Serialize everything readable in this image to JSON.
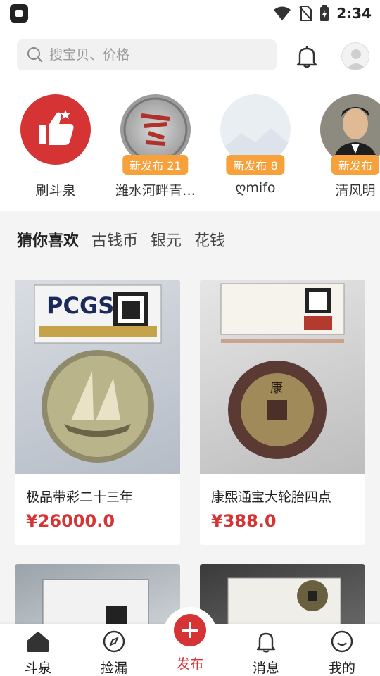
{
  "status": {
    "time": "2:34"
  },
  "search": {
    "placeholder": "搜宝贝、价格"
  },
  "following": [
    {
      "name": "刷斗泉",
      "badge": ""
    },
    {
      "name": "潍水河畔青…",
      "badge": "新发布 21"
    },
    {
      "name": "ღmifo",
      "badge": "新发布 8"
    },
    {
      "name": "清风明",
      "badge": "新发布"
    }
  ],
  "tabs": [
    "猜你喜欢",
    "古钱币",
    "银元",
    "花钱"
  ],
  "products": [
    {
      "title": "极品带彩二十三年",
      "price": "¥26000.0"
    },
    {
      "title": "康熙通宝大轮胎四点",
      "price": "¥388.0"
    }
  ],
  "nav": {
    "items": [
      "斗泉",
      "捡漏",
      "发布",
      "消息",
      "我的"
    ]
  },
  "colors": {
    "accent": "#d63434",
    "badge": "#f6a13b"
  }
}
